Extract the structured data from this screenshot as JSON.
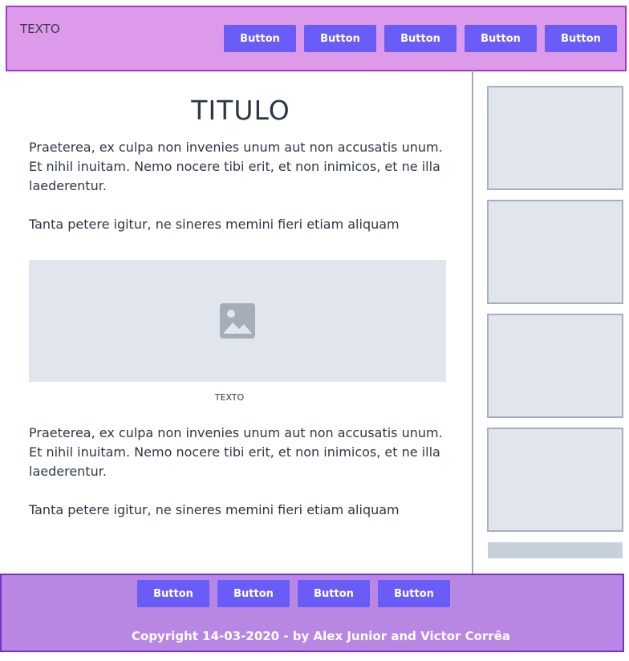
{
  "header": {
    "brand": "TEXTO",
    "buttons": [
      "Button",
      "Button",
      "Button",
      "Button",
      "Button"
    ]
  },
  "main": {
    "title": "TITULO",
    "paragraph_1": "Praeterea, ex culpa non invenies unum aut non accusatis unum. Et nihil inuitam. Nemo nocere tibi erit, et non inimicos, et ne illa laederentur.",
    "paragraph_2": "Tanta petere igitur, ne sineres memini fieri etiam aliquam",
    "figure_caption": "TEXTO",
    "paragraph_3": "Praeterea, ex culpa non invenies unum aut non accusatis unum. Et nihil inuitam. Nemo nocere tibi erit, et non inimicos, et ne illa laederentur.",
    "paragraph_4": "Tanta petere igitur, ne sineres memini fieri etiam aliquam",
    "image_icon": "image-placeholder-icon"
  },
  "footer": {
    "buttons": [
      "Button",
      "Button",
      "Button",
      "Button"
    ],
    "copyright": "Copyright 14-03-2020 - by Alex Junior and Victor Corrêa"
  },
  "colors": {
    "header_bg": "#de9aea",
    "button_bg": "#6a5cf6",
    "footer_bg": "#b787e3",
    "placeholder_bg": "#e0e5ee"
  }
}
